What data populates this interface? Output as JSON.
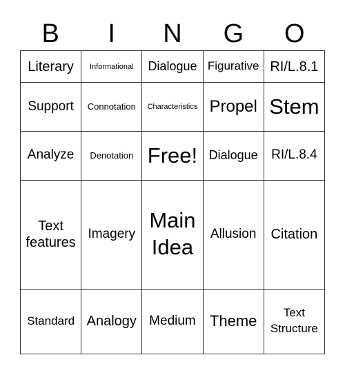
{
  "header": [
    "B",
    "I",
    "N",
    "G",
    "O"
  ],
  "rows": [
    [
      "Literary",
      "Informational",
      "Dialogue",
      "Figurative",
      "RI/L.8.1"
    ],
    [
      "Support",
      "Connotation",
      "Characteristics",
      "Propel",
      "Stem"
    ],
    [
      "Analyze",
      "Denotation",
      "Free!",
      "Dialogue",
      "RI/L.8.4"
    ],
    [
      "Text features",
      "Imagery",
      "Main Idea",
      "Allusion",
      "Citation"
    ],
    [
      "Standard",
      "Analogy",
      "Medium",
      "Theme",
      "Text Structure"
    ]
  ]
}
